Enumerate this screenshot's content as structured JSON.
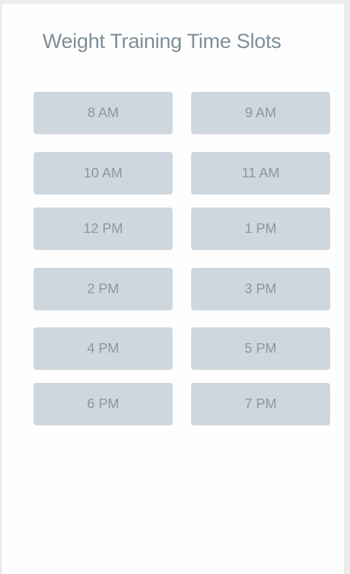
{
  "page": {
    "title": "Weight Training Time Slots"
  },
  "slots": [
    {
      "label": "8 AM"
    },
    {
      "label": "9 AM"
    },
    {
      "label": "10 AM"
    },
    {
      "label": "11 AM"
    },
    {
      "label": "12 PM"
    },
    {
      "label": "1 PM"
    },
    {
      "label": "2 PM"
    },
    {
      "label": "3 PM"
    },
    {
      "label": "4 PM"
    },
    {
      "label": "5 PM"
    },
    {
      "label": "6 PM"
    },
    {
      "label": "7 PM"
    }
  ],
  "colors": {
    "page_background": "#ececec",
    "card_background": "#fefefe",
    "title_text": "#7f8e98",
    "slot_background": "#ced7de",
    "slot_text": "#8b979f"
  }
}
